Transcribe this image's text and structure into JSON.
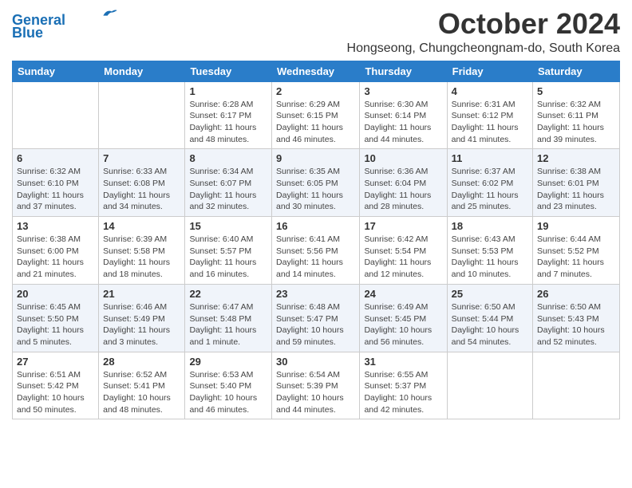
{
  "header": {
    "logo_line1": "General",
    "logo_line2": "Blue",
    "month_title": "October 2024",
    "subtitle": "Hongseong, Chungcheongnam-do, South Korea"
  },
  "weekdays": [
    "Sunday",
    "Monday",
    "Tuesday",
    "Wednesday",
    "Thursday",
    "Friday",
    "Saturday"
  ],
  "weeks": [
    [
      {
        "day": "",
        "info": ""
      },
      {
        "day": "",
        "info": ""
      },
      {
        "day": "1",
        "info": "Sunrise: 6:28 AM\nSunset: 6:17 PM\nDaylight: 11 hours and 48 minutes."
      },
      {
        "day": "2",
        "info": "Sunrise: 6:29 AM\nSunset: 6:15 PM\nDaylight: 11 hours and 46 minutes."
      },
      {
        "day": "3",
        "info": "Sunrise: 6:30 AM\nSunset: 6:14 PM\nDaylight: 11 hours and 44 minutes."
      },
      {
        "day": "4",
        "info": "Sunrise: 6:31 AM\nSunset: 6:12 PM\nDaylight: 11 hours and 41 minutes."
      },
      {
        "day": "5",
        "info": "Sunrise: 6:32 AM\nSunset: 6:11 PM\nDaylight: 11 hours and 39 minutes."
      }
    ],
    [
      {
        "day": "6",
        "info": "Sunrise: 6:32 AM\nSunset: 6:10 PM\nDaylight: 11 hours and 37 minutes."
      },
      {
        "day": "7",
        "info": "Sunrise: 6:33 AM\nSunset: 6:08 PM\nDaylight: 11 hours and 34 minutes."
      },
      {
        "day": "8",
        "info": "Sunrise: 6:34 AM\nSunset: 6:07 PM\nDaylight: 11 hours and 32 minutes."
      },
      {
        "day": "9",
        "info": "Sunrise: 6:35 AM\nSunset: 6:05 PM\nDaylight: 11 hours and 30 minutes."
      },
      {
        "day": "10",
        "info": "Sunrise: 6:36 AM\nSunset: 6:04 PM\nDaylight: 11 hours and 28 minutes."
      },
      {
        "day": "11",
        "info": "Sunrise: 6:37 AM\nSunset: 6:02 PM\nDaylight: 11 hours and 25 minutes."
      },
      {
        "day": "12",
        "info": "Sunrise: 6:38 AM\nSunset: 6:01 PM\nDaylight: 11 hours and 23 minutes."
      }
    ],
    [
      {
        "day": "13",
        "info": "Sunrise: 6:38 AM\nSunset: 6:00 PM\nDaylight: 11 hours and 21 minutes."
      },
      {
        "day": "14",
        "info": "Sunrise: 6:39 AM\nSunset: 5:58 PM\nDaylight: 11 hours and 18 minutes."
      },
      {
        "day": "15",
        "info": "Sunrise: 6:40 AM\nSunset: 5:57 PM\nDaylight: 11 hours and 16 minutes."
      },
      {
        "day": "16",
        "info": "Sunrise: 6:41 AM\nSunset: 5:56 PM\nDaylight: 11 hours and 14 minutes."
      },
      {
        "day": "17",
        "info": "Sunrise: 6:42 AM\nSunset: 5:54 PM\nDaylight: 11 hours and 12 minutes."
      },
      {
        "day": "18",
        "info": "Sunrise: 6:43 AM\nSunset: 5:53 PM\nDaylight: 11 hours and 10 minutes."
      },
      {
        "day": "19",
        "info": "Sunrise: 6:44 AM\nSunset: 5:52 PM\nDaylight: 11 hours and 7 minutes."
      }
    ],
    [
      {
        "day": "20",
        "info": "Sunrise: 6:45 AM\nSunset: 5:50 PM\nDaylight: 11 hours and 5 minutes."
      },
      {
        "day": "21",
        "info": "Sunrise: 6:46 AM\nSunset: 5:49 PM\nDaylight: 11 hours and 3 minutes."
      },
      {
        "day": "22",
        "info": "Sunrise: 6:47 AM\nSunset: 5:48 PM\nDaylight: 11 hours and 1 minute."
      },
      {
        "day": "23",
        "info": "Sunrise: 6:48 AM\nSunset: 5:47 PM\nDaylight: 10 hours and 59 minutes."
      },
      {
        "day": "24",
        "info": "Sunrise: 6:49 AM\nSunset: 5:45 PM\nDaylight: 10 hours and 56 minutes."
      },
      {
        "day": "25",
        "info": "Sunrise: 6:50 AM\nSunset: 5:44 PM\nDaylight: 10 hours and 54 minutes."
      },
      {
        "day": "26",
        "info": "Sunrise: 6:50 AM\nSunset: 5:43 PM\nDaylight: 10 hours and 52 minutes."
      }
    ],
    [
      {
        "day": "27",
        "info": "Sunrise: 6:51 AM\nSunset: 5:42 PM\nDaylight: 10 hours and 50 minutes."
      },
      {
        "day": "28",
        "info": "Sunrise: 6:52 AM\nSunset: 5:41 PM\nDaylight: 10 hours and 48 minutes."
      },
      {
        "day": "29",
        "info": "Sunrise: 6:53 AM\nSunset: 5:40 PM\nDaylight: 10 hours and 46 minutes."
      },
      {
        "day": "30",
        "info": "Sunrise: 6:54 AM\nSunset: 5:39 PM\nDaylight: 10 hours and 44 minutes."
      },
      {
        "day": "31",
        "info": "Sunrise: 6:55 AM\nSunset: 5:37 PM\nDaylight: 10 hours and 42 minutes."
      },
      {
        "day": "",
        "info": ""
      },
      {
        "day": "",
        "info": ""
      }
    ]
  ]
}
